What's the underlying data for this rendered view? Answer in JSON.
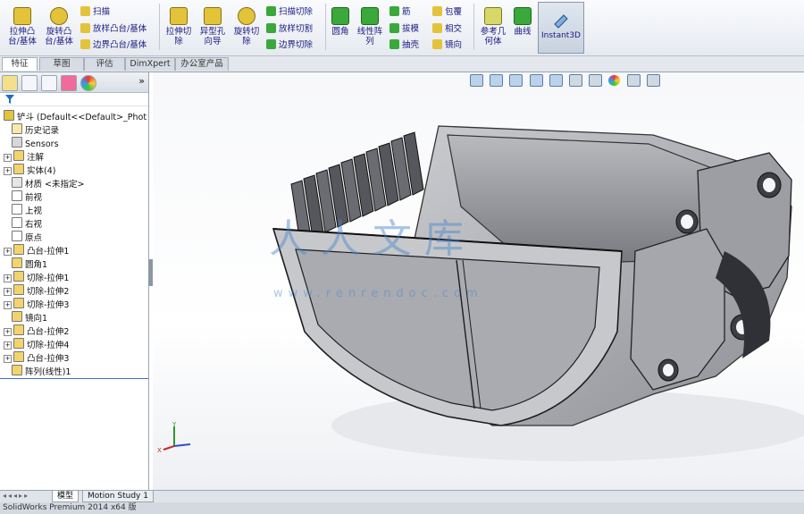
{
  "ribbon": {
    "buttons": [
      {
        "label": "拉伸凸\n台/基体",
        "icon": "extruded-boss-icon"
      },
      {
        "label": "旋转凸\n台/基体",
        "icon": "revolved-boss-icon"
      },
      {
        "label": "拉伸切\n除",
        "icon": "extruded-cut-icon"
      },
      {
        "label": "异型孔\n向导",
        "icon": "hole-wizard-icon"
      },
      {
        "label": "旋转切\n除",
        "icon": "revolved-cut-icon"
      },
      {
        "label": "圆角",
        "icon": "fillet-icon"
      },
      {
        "label": "线性阵\n列",
        "icon": "linear-pattern-icon"
      },
      {
        "label": "参考几\n何体",
        "icon": "reference-geometry-icon"
      },
      {
        "label": "曲线",
        "icon": "curves-icon"
      }
    ],
    "small": {
      "sweep": "扫描",
      "loft": "放样凸台/基体",
      "boundary": "边界凸台/基体",
      "swept_cut": "扫描切除",
      "lofted_cut": "放样切割",
      "boundary_cut": "边界切除",
      "rib": "筋",
      "draft": "拔模",
      "shell": "抽壳",
      "wrap": "包覆",
      "intersect": "相交",
      "mirror": "镜向"
    },
    "instant3d": "Instant3D"
  },
  "tabs": [
    "特征",
    "草图",
    "评估",
    "DimXpert",
    "办公室产品"
  ],
  "tree": {
    "root": "铲斗 (Default<<Default>_Phot",
    "items": [
      {
        "label": "历史记录",
        "expand": false
      },
      {
        "label": "Sensors",
        "expand": false
      },
      {
        "label": "注解",
        "expand": true
      },
      {
        "label": "实体(4)",
        "expand": true
      },
      {
        "label": "材质 <未指定>",
        "expand": false
      },
      {
        "label": "前视",
        "expand": false
      },
      {
        "label": "上视",
        "expand": false
      },
      {
        "label": "右视",
        "expand": false
      },
      {
        "label": "原点",
        "expand": false
      },
      {
        "label": "凸台-拉伸1",
        "expand": true
      },
      {
        "label": "圆角1",
        "expand": false
      },
      {
        "label": "切除-拉伸1",
        "expand": true
      },
      {
        "label": "切除-拉伸2",
        "expand": true
      },
      {
        "label": "切除-拉伸3",
        "expand": true
      },
      {
        "label": "镜向1",
        "expand": false
      },
      {
        "label": "凸台-拉伸2",
        "expand": true
      },
      {
        "label": "切除-拉伸4",
        "expand": true
      },
      {
        "label": "凸台-拉伸3",
        "expand": true
      },
      {
        "label": "阵列(线性)1",
        "expand": false
      }
    ]
  },
  "watermark": {
    "text": "人人文库",
    "url": "www.renrendoc.com"
  },
  "bottom_tabs": [
    "模型",
    "Motion Study 1"
  ],
  "status": "SolidWorks Premium 2014 x64 版",
  "colors": {
    "accent": "#1a1a80",
    "model_fill": "#a9abb0",
    "model_dark": "#3c3e43"
  }
}
